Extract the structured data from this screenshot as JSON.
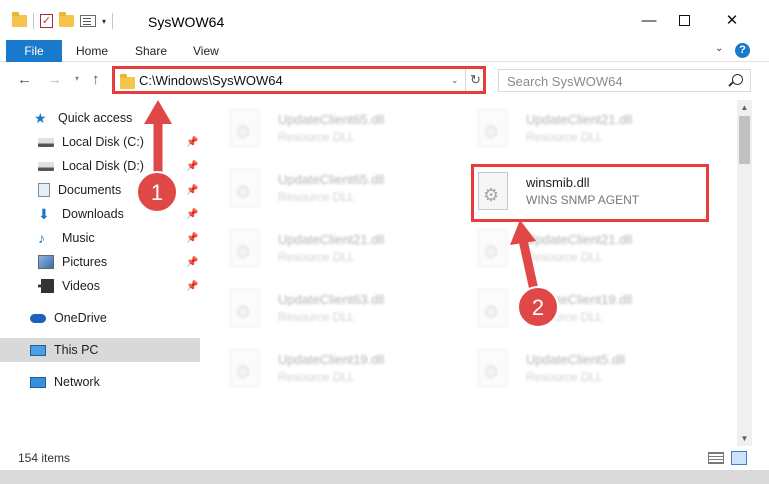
{
  "window": {
    "title": "SysWOW64",
    "minimize_glyph": "—",
    "close_glyph": "✕"
  },
  "quick_access_toolbar": {
    "check_glyph": "✓",
    "dropdown_glyph": "▾"
  },
  "ribbon": {
    "tabs": [
      "File",
      "Home",
      "Share",
      "View"
    ],
    "collapse_glyph": "⌄",
    "help_glyph": "?"
  },
  "navigation": {
    "back_glyph": "←",
    "forward_glyph": "→",
    "recent_glyph": "▾",
    "up_glyph": "↑",
    "address": "C:\\Windows\\SysWOW64",
    "address_dropdown_glyph": "⌄",
    "refresh_glyph": "↻",
    "search_placeholder": "Search SysWOW64"
  },
  "sidebar": {
    "pin_glyph": "📌",
    "items": [
      {
        "label": "Quick access",
        "icon": "star-icon",
        "pinned": false
      },
      {
        "label": "Local Disk (C:)",
        "icon": "disk-icon",
        "pinned": true
      },
      {
        "label": "Local Disk (D:)",
        "icon": "disk-icon",
        "pinned": true
      },
      {
        "label": "Documents",
        "icon": "documents-icon",
        "pinned": true
      },
      {
        "label": "Downloads",
        "icon": "downloads-icon",
        "pinned": true
      },
      {
        "label": "Music",
        "icon": "music-icon",
        "pinned": true
      },
      {
        "label": "Pictures",
        "icon": "pictures-icon",
        "pinned": true
      },
      {
        "label": "Videos",
        "icon": "videos-icon",
        "pinned": true
      },
      {
        "label": "OneDrive",
        "icon": "onedrive-icon",
        "pinned": false
      },
      {
        "label": "This PC",
        "icon": "this-pc-icon",
        "pinned": false,
        "selected": true
      },
      {
        "label": "Network",
        "icon": "network-icon",
        "pinned": false
      }
    ]
  },
  "files": {
    "left_column": [
      {
        "name": "UpdateClient65.dll",
        "type": "Resource DLL"
      },
      {
        "name": "UpdateClient65.dll",
        "type": "Resource DLL"
      },
      {
        "name": "UpdateClient21.dll",
        "type": "Resource DLL"
      },
      {
        "name": "UpdateClient63.dll",
        "type": "Resource DLL"
      },
      {
        "name": "UpdateClient19.dll",
        "type": "Resource DLL"
      }
    ],
    "right_column": [
      {
        "name": "UpdateClient21.dll",
        "type": "Resource DLL"
      },
      {
        "name": "winsmib.dll",
        "type": "WINS SNMP AGENT",
        "highlighted": true
      },
      {
        "name": "UpdateClient21.dll",
        "type": "Resource DLL"
      },
      {
        "name": "UpdateClient19.dll",
        "type": "Resource DLL"
      },
      {
        "name": "UpdateClient5.dll",
        "type": "Resource DLL"
      }
    ]
  },
  "scrollbar": {
    "up_glyph": "▲",
    "down_glyph": "▼"
  },
  "status": {
    "item_count": "154 items"
  },
  "annotations": [
    {
      "label": "1",
      "color": "#e04848"
    },
    {
      "label": "2",
      "color": "#e04848"
    }
  ]
}
